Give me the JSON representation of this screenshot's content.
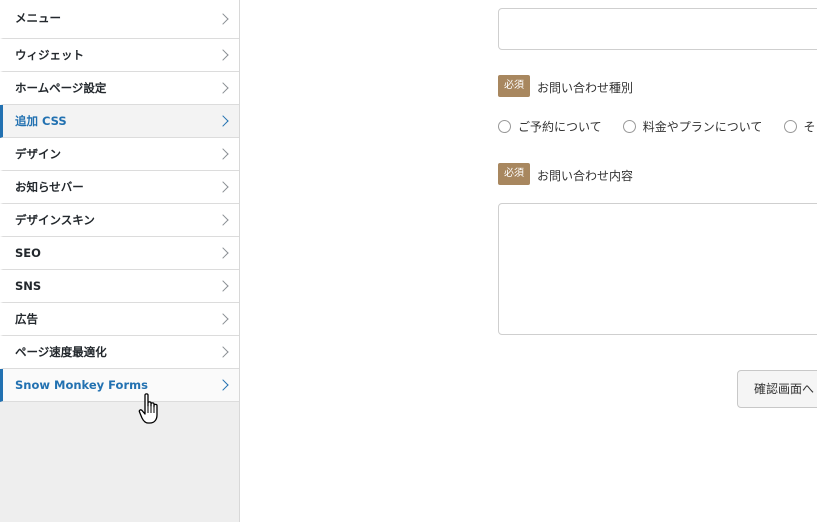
{
  "sidebar": {
    "items": [
      {
        "label": "メニュー"
      },
      {
        "label": "ウィジェット"
      },
      {
        "label": "ホームページ設定"
      },
      {
        "label": "追加 CSS"
      },
      {
        "label": "デザイン"
      },
      {
        "label": "お知らせバー"
      },
      {
        "label": "デザインスキン"
      },
      {
        "label": "SEO"
      },
      {
        "label": "SNS"
      },
      {
        "label": "広告"
      },
      {
        "label": "ページ速度最適化"
      },
      {
        "label": "Snow Monkey Forms"
      }
    ]
  },
  "form": {
    "inquiry_type": {
      "badge": "必須",
      "label": "お問い合わせ種別",
      "options": [
        "ご予約について",
        "料金やプランについて",
        "そ"
      ]
    },
    "inquiry_content": {
      "badge": "必須",
      "label": "お問い合わせ内容"
    },
    "confirm_button": "確認画面へ"
  },
  "colors": {
    "accent": "#2271b1",
    "badge": "#a8875f"
  }
}
